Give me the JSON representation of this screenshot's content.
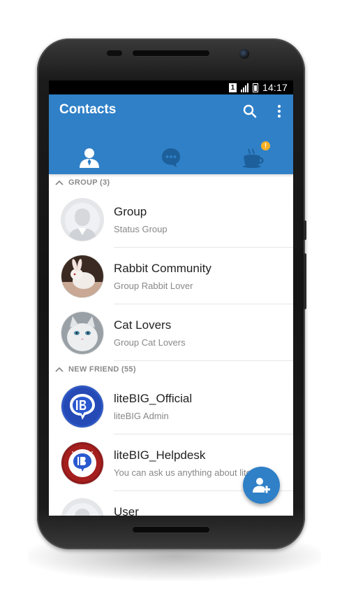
{
  "statusbar": {
    "sim_slot": "1",
    "time": "14:17"
  },
  "appbar": {
    "title": "Contacts",
    "tabs": [
      {
        "icon": "person-icon",
        "active": true
      },
      {
        "icon": "chat-bubble-icon",
        "active": false
      },
      {
        "icon": "coffee-cup-icon",
        "active": false,
        "badge": "!"
      }
    ],
    "accent_color": "#2f80c7"
  },
  "sections": [
    {
      "header": "GROUP (3)",
      "items": [
        {
          "name": "Group",
          "status": "Status Group",
          "avatar": "default-avatar-icon"
        },
        {
          "name": "Rabbit Community",
          "status": "Group Rabbit Lover",
          "avatar": "rabbit-photo"
        },
        {
          "name": "Cat Lovers",
          "status": "Group Cat Lovers",
          "avatar": "cat-photo"
        }
      ]
    },
    {
      "header": "NEW FRIEND (55)",
      "items": [
        {
          "name": "liteBIG_Official",
          "status": "liteBIG Admin",
          "avatar": "litebig-logo"
        },
        {
          "name": "liteBIG_Helpdesk",
          "status": "You can ask us anything about liteBIG...",
          "avatar": "litebig-helpdesk-logo"
        },
        {
          "name": "User",
          "status": "",
          "avatar": "default-avatar-icon"
        }
      ]
    }
  ],
  "fab": {
    "icon": "add-contact-icon"
  }
}
